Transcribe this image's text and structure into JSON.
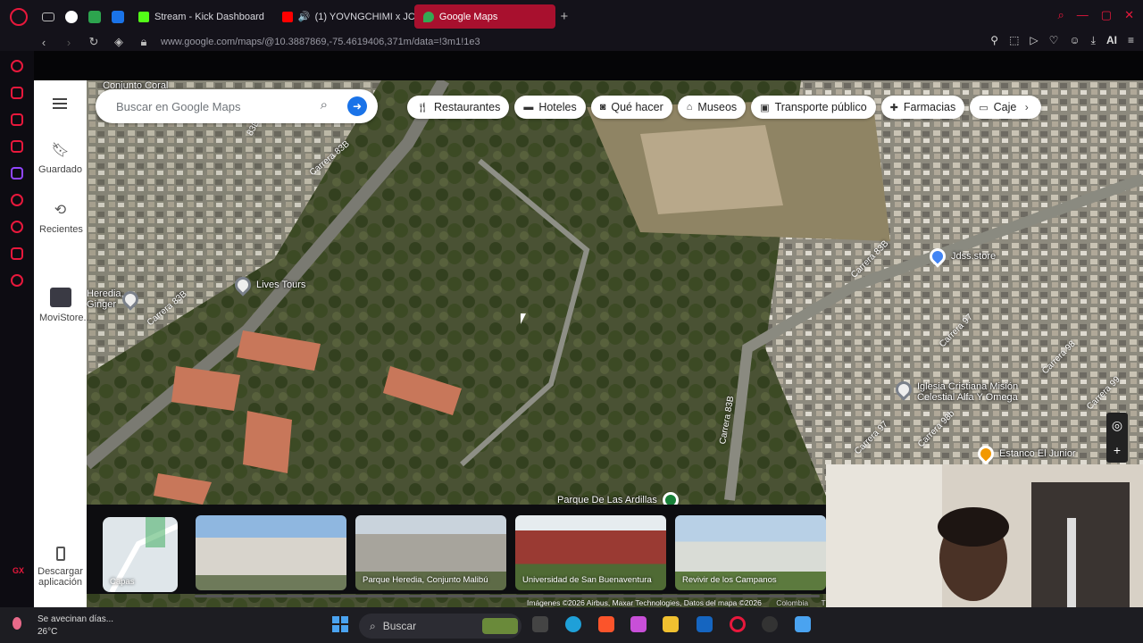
{
  "tabs": [
    {
      "label": "Stream - Kick Dashboard",
      "color": "#53fc18"
    },
    {
      "label": "(1) YOVNGCHIMI x JC",
      "color": "#ff0000"
    },
    {
      "label": "Google Maps",
      "color": "#34a853",
      "active": true
    }
  ],
  "address": {
    "url": "www.google.com/maps/@10.3887869,-75.4619406,371m/data=!3m1!1e3"
  },
  "toolbar": {
    "ai_label": "AI"
  },
  "opera": {
    "gx_label": "GX"
  },
  "maps": {
    "search_placeholder": "Buscar en Google Maps",
    "rail": {
      "saved": "Guardado",
      "recent": "Recientes",
      "movistore": "MoviStore...",
      "download": "Descargar aplicación"
    },
    "chips": [
      {
        "label": "Restaurantes",
        "icon": "fork-knife-icon"
      },
      {
        "label": "Hoteles",
        "icon": "bed-icon"
      },
      {
        "label": "Qué hacer",
        "icon": "camera-icon"
      },
      {
        "label": "Museos",
        "icon": "museum-icon"
      },
      {
        "label": "Transporte público",
        "icon": "bus-icon"
      },
      {
        "label": "Farmacias",
        "icon": "pharmacy-icon"
      },
      {
        "label": "Cajeros",
        "icon": "atm-icon"
      }
    ],
    "places": [
      {
        "label": "Lives Tours",
        "kind": "default"
      },
      {
        "label": "Jdss.store",
        "kind": "blue"
      },
      {
        "label": "Iglesia Cristiana Misión Celestial Alfa Y Omega",
        "kind": "default"
      },
      {
        "label": "Estanco El Junior",
        "kind": "orange"
      },
      {
        "label": "Parque De Las Ardillas",
        "kind": "park"
      },
      {
        "label": "Conjunto Coral",
        "kind": "default"
      },
      {
        "label": "Heredia, Ginger",
        "kind": "default"
      }
    ],
    "roads": [
      "Carrera 83B",
      "Carrera 83B",
      "Carrera 83B",
      "Carrera 83B",
      "Carrera 97",
      "Carrera 98",
      "Carrera 99",
      "Carrera 98b",
      "Carrera 97",
      "83B"
    ],
    "layers_label": "Capas",
    "thumbs": [
      {
        "caption": ""
      },
      {
        "caption": "Parque Heredia, Conjunto Malibú"
      },
      {
        "caption": "Universidad de San Buenaventura"
      },
      {
        "caption": "Revivir de los Campanos"
      }
    ],
    "copyright": "Imágenes ©2026 Airbus, Maxar Technologies, Datos del mapa ©2026",
    "country": "Colombia",
    "terms": "Térm"
  },
  "taskbar": {
    "weather_text": "Se avecinan días...",
    "temp": "26°C",
    "search_label": "Buscar"
  }
}
